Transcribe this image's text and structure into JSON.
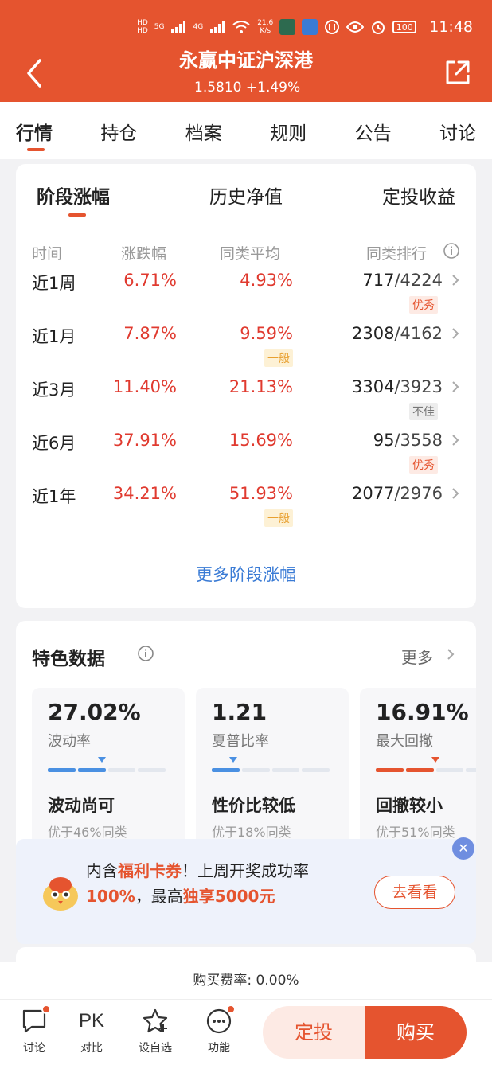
{
  "status_bar": {
    "hd1": "HD",
    "hd2": "HD",
    "net1": "5G",
    "net2": "4G",
    "speed": "21.6",
    "speed_unit": "K/s",
    "battery": "100",
    "time": "11:48"
  },
  "header": {
    "title": "永赢中证沪深港",
    "subtitle": "1.5810 +1.49%"
  },
  "tabs": [
    "行情",
    "持仓",
    "档案",
    "规则",
    "公告",
    "讨论"
  ],
  "period_card": {
    "subtabs": [
      "阶段涨幅",
      "历史净值",
      "定投收益"
    ],
    "columns": [
      "时间",
      "涨跌幅",
      "同类平均",
      "同类排行"
    ],
    "rows": [
      {
        "period": "近1周",
        "change": "6.71%",
        "avg": "4.93%",
        "rank": "717",
        "total": "/4224",
        "badge": "优秀",
        "badge_type": "good"
      },
      {
        "period": "近1月",
        "change": "7.87%",
        "avg": "9.59%",
        "rank": "2308",
        "total": "/4162",
        "badge": "一般",
        "badge_type": "avg"
      },
      {
        "period": "近3月",
        "change": "11.40%",
        "avg": "21.13%",
        "rank": "3304",
        "total": "/3923",
        "badge": "不佳",
        "badge_type": "bad"
      },
      {
        "period": "近6月",
        "change": "37.91%",
        "avg": "15.69%",
        "rank": "95",
        "total": "/3558",
        "badge": "优秀",
        "badge_type": "good"
      },
      {
        "period": "近1年",
        "change": "34.21%",
        "avg": "51.93%",
        "rank": "2077",
        "total": "/2976",
        "badge": "一般",
        "badge_type": "avg"
      }
    ],
    "more_link": "更多阶段涨幅"
  },
  "feature_card": {
    "title": "特色数据",
    "more": "更多",
    "metrics": [
      {
        "value": "27.02%",
        "label": "波动率",
        "desc": "波动尚可",
        "sub": "优于46%同类",
        "level": 0.46,
        "color": "#4a90e2"
      },
      {
        "value": "1.21",
        "label": "夏普比率",
        "desc": "性价比较低",
        "sub": "优于18%同类",
        "level": 0.18,
        "color": "#4a90e2"
      },
      {
        "value": "16.91%",
        "label": "最大回撤",
        "desc": "回撤较小",
        "sub": "优于51%同类",
        "level": 0.51,
        "color": "#e5542f"
      }
    ]
  },
  "promo": {
    "l1_a": "内含",
    "l1_hl": "福利卡券",
    "l1_b": "！上周开奖成功率",
    "l2_hl1": "100%",
    "l2_a": "，最高",
    "l2_hl2": "独享5000元",
    "button": "去看看",
    "close": "✕"
  },
  "fee": "购买费率: 0.00%",
  "bottom_nav": [
    {
      "label": "讨论",
      "icon": "chat-icon"
    },
    {
      "label": "对比",
      "icon": "pk-icon",
      "text": "PK"
    },
    {
      "label": "设自选",
      "icon": "star-icon"
    },
    {
      "label": "功能",
      "icon": "more-icon"
    }
  ],
  "actions": {
    "dingtou": "定投",
    "buy": "购买"
  },
  "colors": {
    "brand": "#e5542f",
    "link": "#3a7bd5",
    "rise": "#e03a2f"
  }
}
